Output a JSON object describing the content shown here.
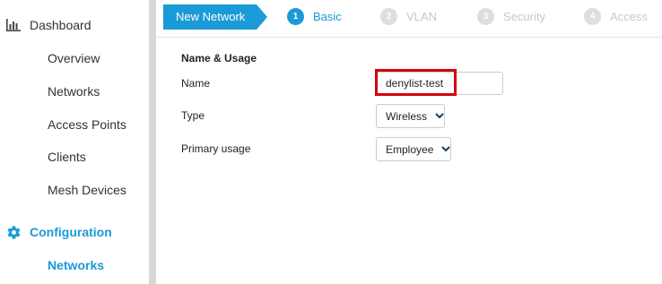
{
  "sidebar": {
    "dashboard": {
      "label": "Dashboard",
      "icon": "bar-chart-icon"
    },
    "dashboard_items": [
      {
        "label": "Overview"
      },
      {
        "label": "Networks"
      },
      {
        "label": "Access Points"
      },
      {
        "label": "Clients"
      },
      {
        "label": "Mesh Devices"
      }
    ],
    "configuration": {
      "label": "Configuration",
      "icon": "gear-icon"
    },
    "configuration_items": [
      {
        "label": "Networks",
        "active": true
      }
    ]
  },
  "wizard": {
    "start_label": "New Network",
    "steps": [
      {
        "number": "1",
        "label": "Basic",
        "state": "current"
      },
      {
        "number": "2",
        "label": "VLAN",
        "state": "pending"
      },
      {
        "number": "3",
        "label": "Security",
        "state": "pending"
      },
      {
        "number": "4",
        "label": "Access",
        "state": "pending"
      }
    ]
  },
  "form": {
    "section_title": "Name & Usage",
    "name": {
      "label": "Name",
      "value": "denylist-test"
    },
    "type": {
      "label": "Type",
      "value": "Wireless"
    },
    "primary_usage": {
      "label": "Primary usage",
      "value": "Employee"
    }
  },
  "colors": {
    "accent": "#1a9ad6",
    "highlight": "#d4000b",
    "pending_step": "#dedede"
  }
}
